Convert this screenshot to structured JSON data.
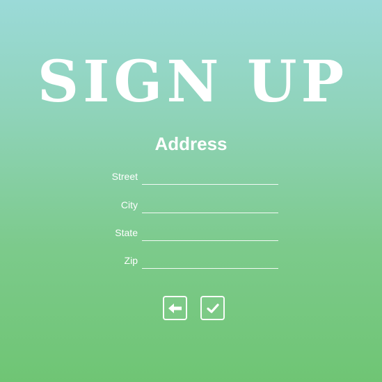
{
  "header": {
    "title": "SIGN UP"
  },
  "form": {
    "section_title": "Address",
    "fields": [
      {
        "label": "Street",
        "value": "",
        "placeholder": ""
      },
      {
        "label": "City",
        "value": "",
        "placeholder": ""
      },
      {
        "label": "State",
        "value": "",
        "placeholder": ""
      },
      {
        "label": "Zip",
        "value": "",
        "placeholder": ""
      }
    ]
  },
  "actions": {
    "back_icon": "arrow-left-icon",
    "submit_icon": "checkmark-icon"
  },
  "colors": {
    "gradient_top": "#9bdad8",
    "gradient_bottom": "#6fc574",
    "foreground": "#ffffff"
  }
}
